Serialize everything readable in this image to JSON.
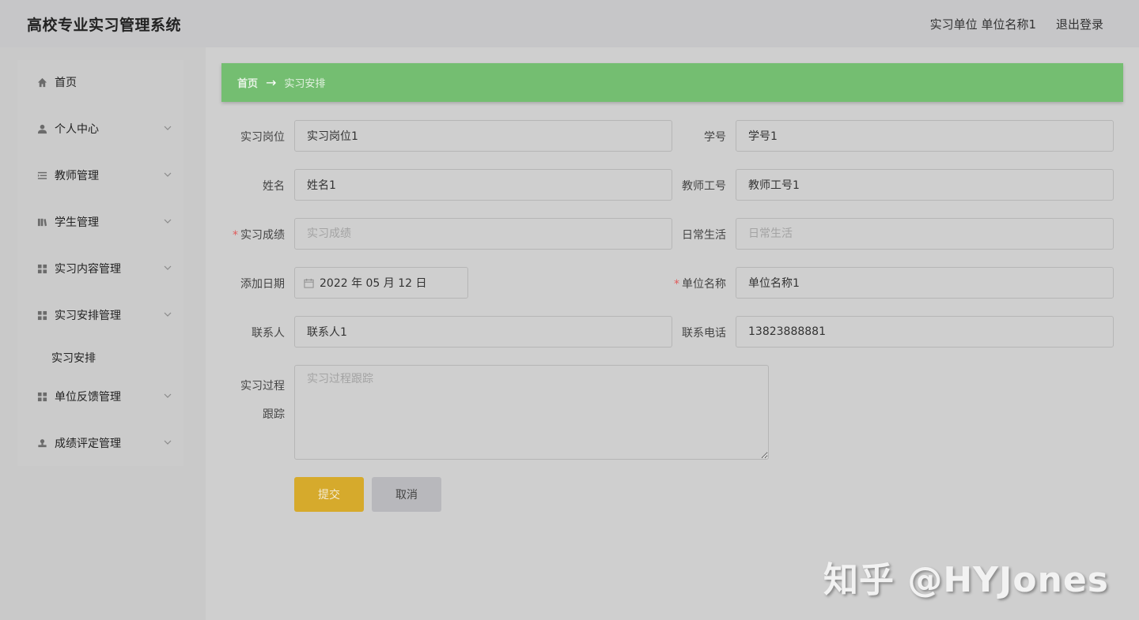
{
  "header": {
    "title": "高校专业实习管理系统",
    "user": "实习单位 单位名称1",
    "logout": "退出登录"
  },
  "sidebar": {
    "items": [
      {
        "label": "首页",
        "icon": "home-icon"
      },
      {
        "label": "个人中心",
        "icon": "user-icon"
      },
      {
        "label": "教师管理",
        "icon": "list-icon"
      },
      {
        "label": "学生管理",
        "icon": "books-icon"
      },
      {
        "label": "实习内容管理",
        "icon": "grid-icon"
      },
      {
        "label": "实习安排管理",
        "icon": "grid-icon"
      },
      {
        "label": "单位反馈管理",
        "icon": "grid-icon"
      },
      {
        "label": "成绩评定管理",
        "icon": "stamp-icon"
      }
    ],
    "sub_item": "实习安排"
  },
  "breadcrumb": {
    "home": "首页",
    "arrow": "→",
    "current": "实习安排"
  },
  "form": {
    "position": {
      "label": "实习岗位",
      "value": "实习岗位1"
    },
    "student_no": {
      "label": "学号",
      "value": "学号1"
    },
    "name": {
      "label": "姓名",
      "value": "姓名1"
    },
    "teacher_no": {
      "label": "教师工号",
      "value": "教师工号1"
    },
    "grade": {
      "label": "实习成绩",
      "placeholder": "实习成绩",
      "required_mark": "*"
    },
    "daily_life": {
      "label": "日常生活",
      "placeholder": "日常生活"
    },
    "add_date": {
      "label": "添加日期",
      "value": "2022 年 05 月 12 日"
    },
    "unit_name": {
      "label": "单位名称",
      "value": "单位名称1",
      "required_mark": "*"
    },
    "contact": {
      "label": "联系人",
      "value": "联系人1"
    },
    "phone": {
      "label": "联系电话",
      "value": "13823888881"
    },
    "tracking": {
      "label_line1": "实习过程",
      "label_line2": "跟踪",
      "placeholder": "实习过程跟踪"
    },
    "submit": "提交",
    "cancel": "取消"
  },
  "watermark": "知乎 @HYJones"
}
